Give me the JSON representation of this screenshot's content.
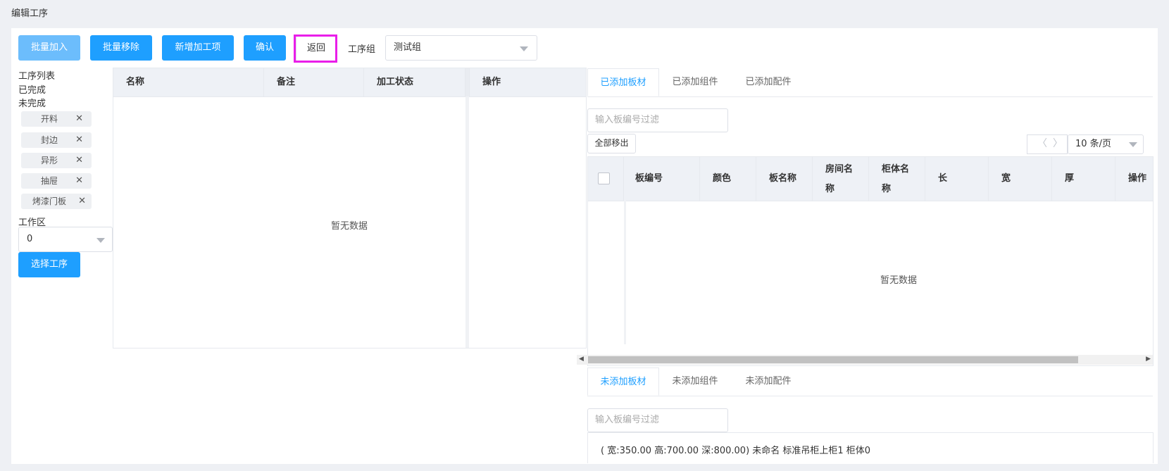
{
  "page": {
    "title": "编辑工序"
  },
  "toolbar": {
    "batch_add": "批量加入",
    "batch_remove": "批量移除",
    "add_process": "新增加工项",
    "confirm": "确认",
    "back": "返回",
    "group_label": "工序组",
    "group_value": "测试组"
  },
  "left": {
    "list_title": "工序列表",
    "done": "已完成",
    "undone": "未完成",
    "tags": [
      "开料",
      "封边",
      "异形",
      "抽屉",
      "烤漆门板"
    ],
    "workarea_label": "工作区",
    "workarea_value": "0",
    "choose_button": "选择工序"
  },
  "process_table": {
    "columns": [
      "名称",
      "备注",
      "加工状态"
    ],
    "action_column": "操作",
    "empty_text": "暂无数据"
  },
  "added_tabs": {
    "items": [
      "已添加板材",
      "已添加组件",
      "已添加配件"
    ],
    "active": 0
  },
  "added": {
    "filter_placeholder": "输入板编号过滤",
    "remove_all": "全部移出",
    "page_size": "10 条/页",
    "columns": [
      "板编号",
      "颜色",
      "板名称",
      "房间名称",
      "柜体名称",
      "长",
      "宽",
      "厚",
      "操作"
    ],
    "empty_text": "暂无数据"
  },
  "unadded_tabs": {
    "items": [
      "未添加板材",
      "未添加组件",
      "未添加配件"
    ],
    "active": 0
  },
  "unadded": {
    "filter_placeholder": "输入板编号过滤",
    "item_text": "( 宽:350.00 高:700.00 深:800.00) 未命名 标准吊柜上柜1 柜体0"
  },
  "icons": {
    "close": "close-icon",
    "caret": "chevron-down-icon",
    "prev": "chevron-left-icon",
    "next": "chevron-right-icon"
  },
  "colors": {
    "primary": "#1e9fff",
    "highlight": "#e91ee9"
  }
}
